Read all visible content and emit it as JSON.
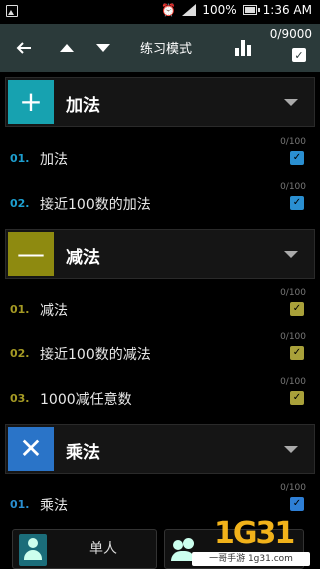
{
  "status_bar": {
    "battery": "100%",
    "time": "1:36 AM"
  },
  "toolbar": {
    "title": "练习模式",
    "score": "0/9000",
    "back_icon": "arrow-left-icon",
    "up_icon": "triangle-up-icon",
    "down_icon": "triangle-down-icon",
    "chart_icon": "bar-chart-icon",
    "check_mark": "✓"
  },
  "categories": [
    {
      "label": "加法",
      "icon_glyph": "+",
      "icon_color": "#17a2b0",
      "accent": "#1d9fd0",
      "check_color": "#2a8fd1",
      "items": [
        {
          "num": "01.",
          "label": "加法",
          "count": "0/100",
          "checked": "✓"
        },
        {
          "num": "02.",
          "label": "接近100数的加法",
          "count": "0/100",
          "checked": "✓"
        }
      ]
    },
    {
      "label": "减法",
      "icon_glyph": "—",
      "icon_color": "#8e8a10",
      "accent": "#a59a24",
      "check_color": "#a9a13a",
      "items": [
        {
          "num": "01.",
          "label": "减法",
          "count": "0/100",
          "checked": "✓"
        },
        {
          "num": "02.",
          "label": "接近100数的减法",
          "count": "0/100",
          "checked": "✓"
        },
        {
          "num": "03.",
          "label": "1000减任意数",
          "count": "0/100",
          "checked": "✓"
        }
      ]
    },
    {
      "label": "乘法",
      "icon_glyph": "✕",
      "icon_color": "#2a74c8",
      "accent": "#2a8fd1",
      "check_color": "#2e7fd6",
      "items": [
        {
          "num": "01.",
          "label": "乘法",
          "count": "0/100",
          "checked": "✓"
        }
      ]
    }
  ],
  "bottom": {
    "single_label": "单人",
    "single_icon": "person-icon",
    "multi_icon": "group-icon"
  },
  "watermark": {
    "digits": "1G31",
    "text": "一哥手游 1g31.com"
  }
}
